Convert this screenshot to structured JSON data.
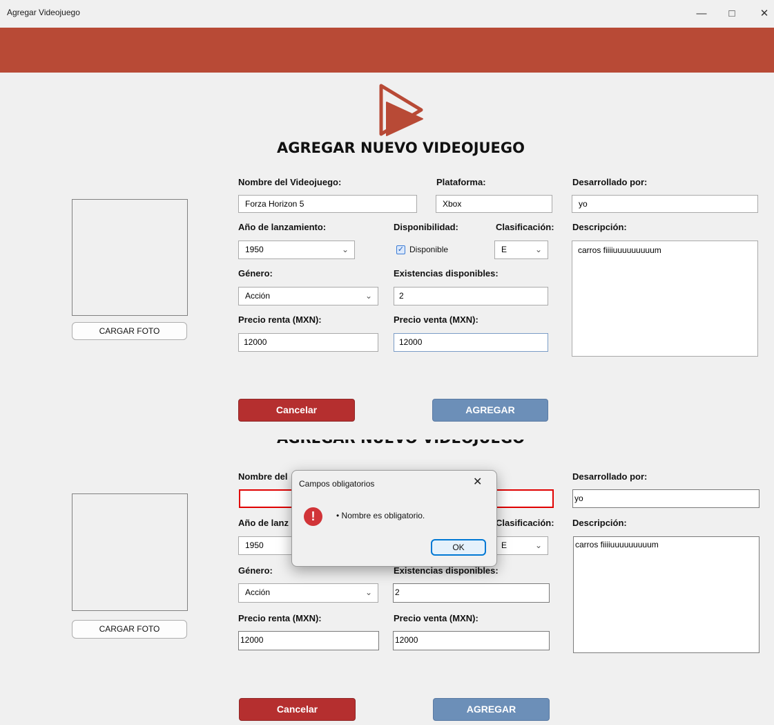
{
  "window": {
    "title": "Agregar Videojuego",
    "minimize_icon": "minimize-icon",
    "maximize_icon": "maximize-icon",
    "close_icon": "close-icon"
  },
  "colors": {
    "banner": "#b84a36",
    "cancel": "#b52f2f",
    "add": "#6c8fb8",
    "error_border": "#e00000"
  },
  "logo_icon": "play-icon",
  "heading": "AGREGAR NUEVO VIDEOJUEGO",
  "labels": {
    "nombre": "Nombre del Videojuego:",
    "plataforma": "Plataforma:",
    "desarrollado": "Desarrollado por:",
    "anio": "Año de lanzamiento:",
    "disponibilidad": "Disponibilidad:",
    "clasificacion": "Clasificación:",
    "descripcion": "Descripción:",
    "genero": "Género:",
    "existencias": "Existencias disponibles:",
    "precio_renta": "Precio renta (MXN):",
    "precio_venta": "Precio venta (MXN):"
  },
  "form_top": {
    "nombre": "Forza Horizon 5",
    "plataforma": "Xbox",
    "desarrollado": "yo",
    "anio": "1950",
    "disponible_label": "Disponible",
    "disponible_checked": true,
    "clasificacion": "E",
    "descripcion": "carros fiiiiuuuuuuuuum",
    "genero": "Acción",
    "existencias": "2",
    "precio_renta": "12000",
    "precio_venta": "12000"
  },
  "form_bottom": {
    "nombre_partial": "Nombre del",
    "anio_partial": "Año de lanz",
    "nombre": "",
    "desarrollado": "yo",
    "anio": "1950",
    "clasificacion": "E",
    "descripcion": "carros fiiiiuuuuuuuuum",
    "genero": "Acción",
    "existencias": "2",
    "precio_renta": "12000",
    "precio_venta": "12000"
  },
  "buttons": {
    "cargar_foto": "CARGAR FOTO",
    "cancelar": "Cancelar",
    "agregar": "AGREGAR"
  },
  "dialog": {
    "title": "Campos obligatorios",
    "close_icon": "close-icon",
    "error_icon": "error-icon",
    "icon_glyph": "!",
    "message": "• Nombre es obligatorio.",
    "ok": "OK"
  }
}
